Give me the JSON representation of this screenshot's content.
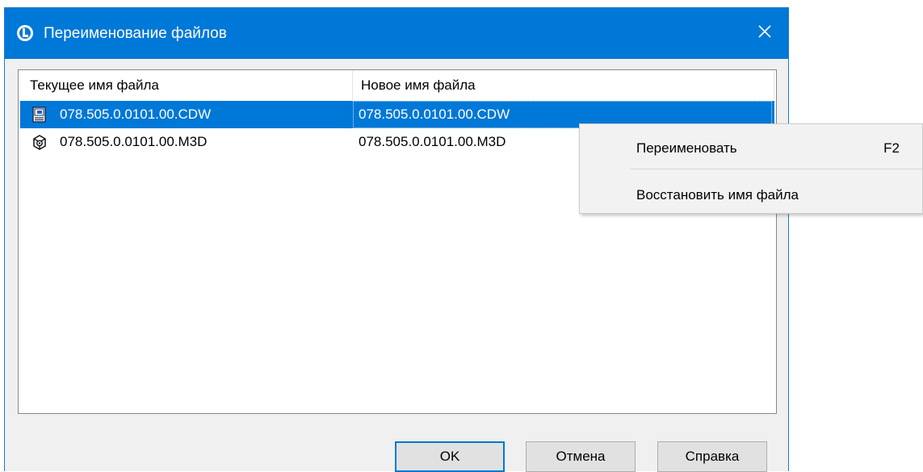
{
  "window": {
    "title": "Переименование файлов",
    "accent_color": "#0078d7",
    "app_icon": "kompas-logo-icon",
    "close_icon": "close-icon"
  },
  "list": {
    "columns": [
      "Текущее имя файла",
      "Новое имя файла"
    ],
    "rows": [
      {
        "icon": "drawing-file-icon",
        "current": "078.505.0.0101.00.CDW",
        "new": "078.505.0.0101.00.CDW",
        "selected": true
      },
      {
        "icon": "3d-model-file-icon",
        "current": "078.505.0.0101.00.M3D",
        "new": "078.505.0.0101.00.M3D",
        "selected": false
      }
    ]
  },
  "buttons": {
    "ok": "OK",
    "cancel": "Отмена",
    "help": "Справка"
  },
  "context_menu": {
    "items": [
      {
        "label": "Переименовать",
        "shortcut": "F2"
      },
      {
        "label": "Восстановить имя файла",
        "shortcut": ""
      }
    ]
  }
}
